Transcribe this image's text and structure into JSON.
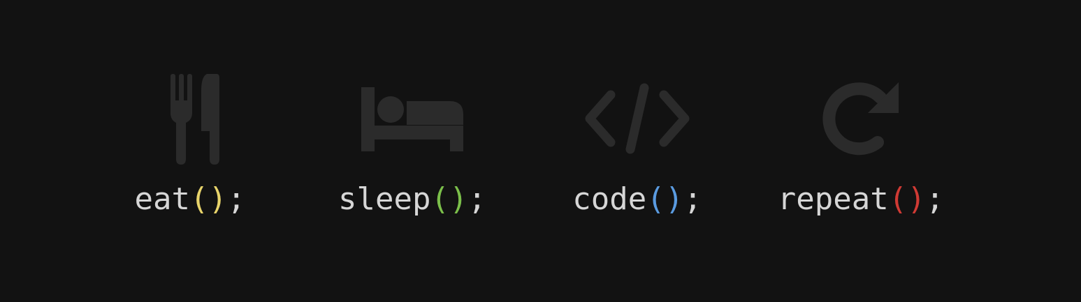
{
  "background": "#121212",
  "icon_color": "#2b2b2b",
  "items": [
    {
      "icon": "fork-knife-icon",
      "name": "eat",
      "paren": "()",
      "semi": ";",
      "paren_color": "#e8d46b"
    },
    {
      "icon": "bed-icon",
      "name": "sleep",
      "paren": "()",
      "semi": ";",
      "paren_color": "#7bbf4a"
    },
    {
      "icon": "code-icon",
      "name": "code",
      "paren": "()",
      "semi": ";",
      "paren_color": "#5a9be0"
    },
    {
      "icon": "repeat-icon",
      "name": "repeat",
      "paren": "()",
      "semi": ";",
      "paren_color": "#d03a34"
    }
  ]
}
